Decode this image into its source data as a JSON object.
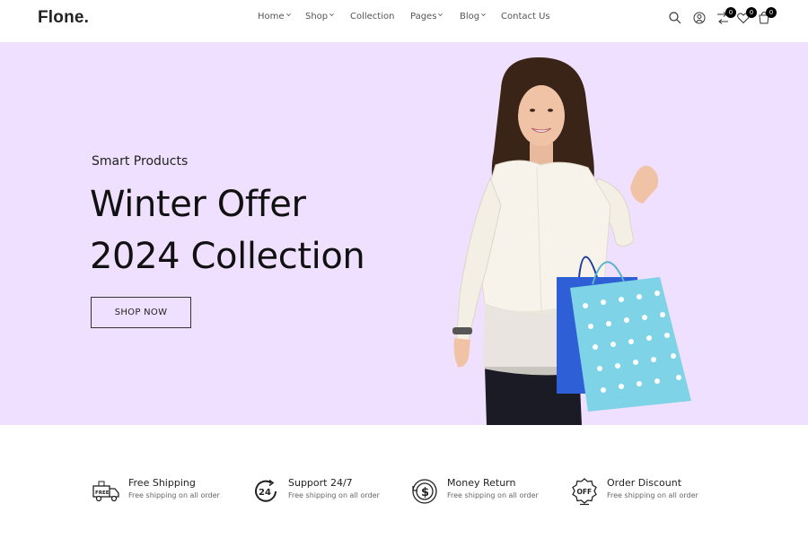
{
  "header": {
    "logo": "Flone.",
    "nav": [
      {
        "label": "Home",
        "has_dropdown": true
      },
      {
        "label": "Shop",
        "has_dropdown": true
      },
      {
        "label": "Collection",
        "has_dropdown": false
      },
      {
        "label": "Pages",
        "has_dropdown": true
      },
      {
        "label": "Blog",
        "has_dropdown": true
      },
      {
        "label": "Contact Us",
        "has_dropdown": false
      }
    ],
    "icons": {
      "search": "search-icon",
      "account": "user-icon",
      "compare": {
        "icon": "compare-icon",
        "count": "0"
      },
      "wishlist": {
        "icon": "heart-icon",
        "count": "0"
      },
      "cart": {
        "icon": "cart-icon",
        "count": "0"
      }
    }
  },
  "hero": {
    "subtitle": "Smart Products",
    "title_line1": "Winter Offer",
    "title_line2": "2024 Collection",
    "button_label": "SHOP NOW",
    "background_color": "#f0e0ff",
    "image": "woman-with-shopping-bags"
  },
  "features": [
    {
      "icon": "free-delivery-truck-icon",
      "title": "Free Shipping",
      "subtitle": "Free shipping on all order"
    },
    {
      "icon": "support-24-icon",
      "title": "Support 24/7",
      "subtitle": "Free shipping on all order"
    },
    {
      "icon": "money-return-icon",
      "title": "Money Return",
      "subtitle": "Free shipping on all order"
    },
    {
      "icon": "discount-off-icon",
      "title": "Order Discount",
      "subtitle": "Free shipping on all order"
    }
  ]
}
